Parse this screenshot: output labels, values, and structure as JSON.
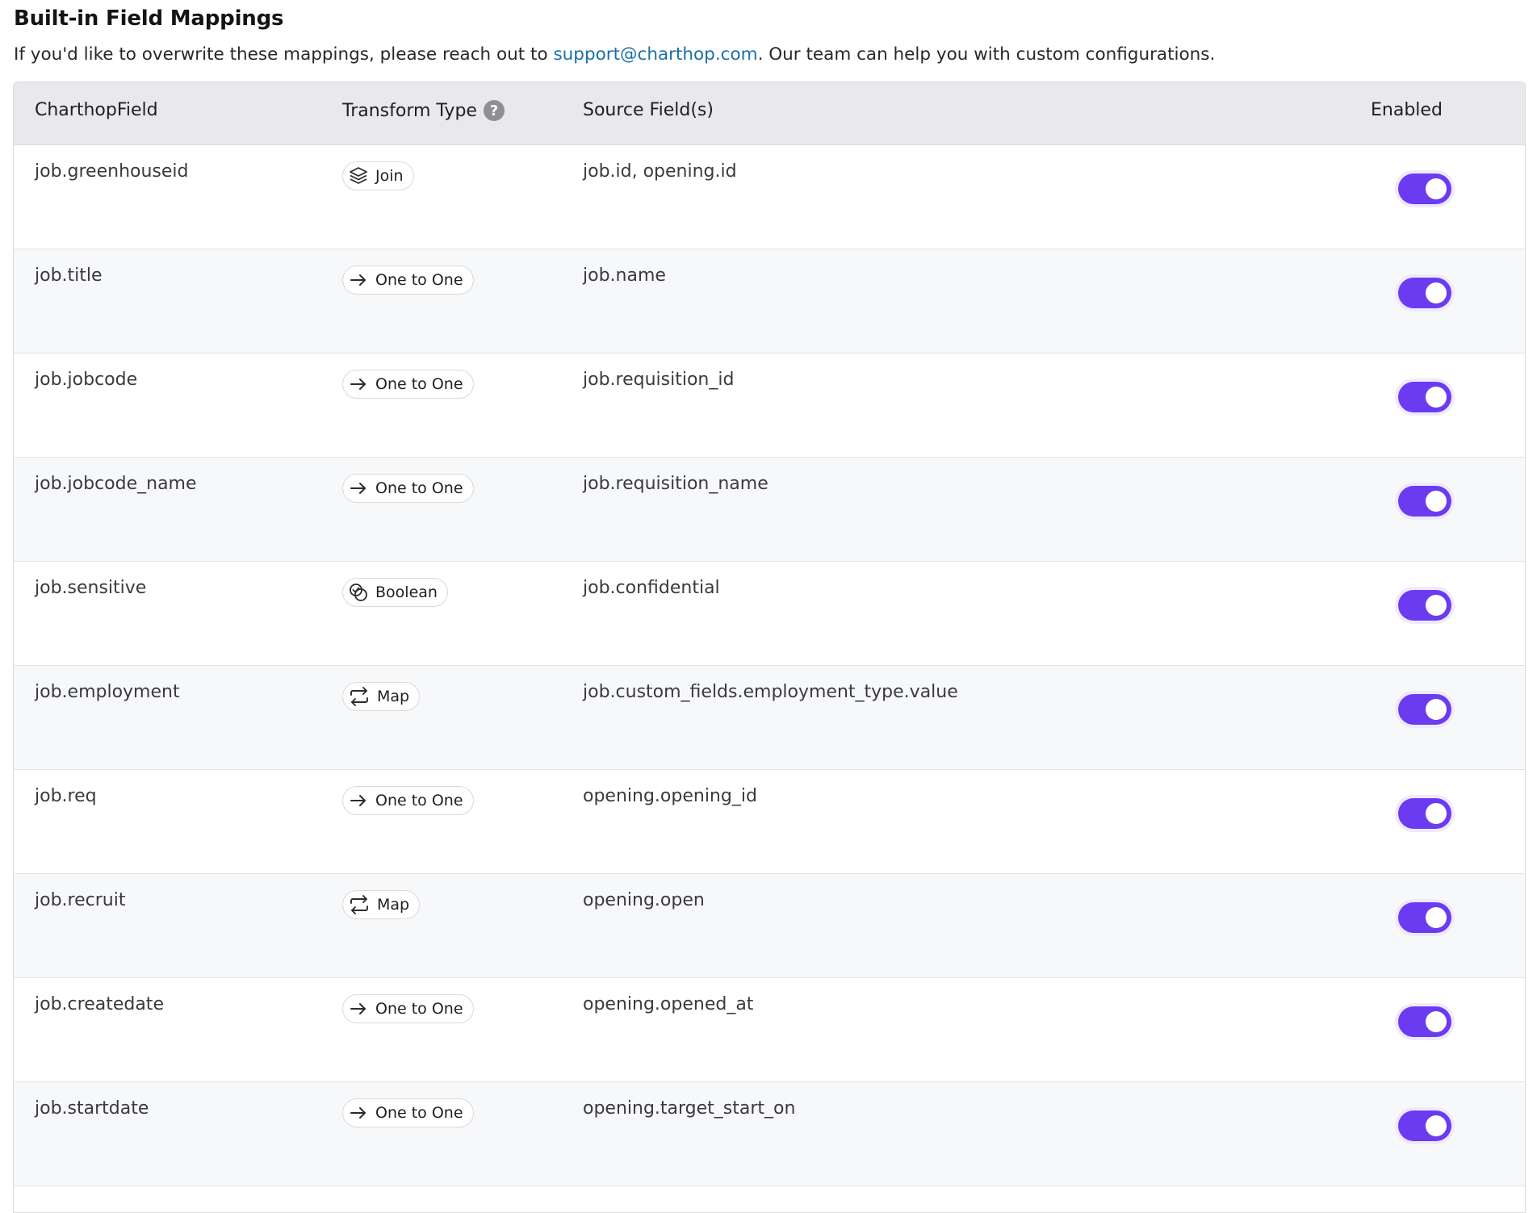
{
  "header": {
    "title": "Built-in Field Mappings",
    "subtitle_before": "If you'd like to overwrite these mappings, please reach out to ",
    "support_email": "support@charthop.com",
    "subtitle_after": ". Our team can help you with custom configurations."
  },
  "table": {
    "columns": {
      "field": "CharthopField",
      "transform": "Transform Type",
      "source": "Source Field(s)",
      "enabled": "Enabled"
    },
    "help_icon": "help-circle-icon",
    "rows": [
      {
        "field": "job.greenhouseid",
        "transform": "Join",
        "transform_icon": "layers-icon",
        "source": "job.id, opening.id",
        "enabled": true
      },
      {
        "field": "job.title",
        "transform": "One to One",
        "transform_icon": "arrow-right-icon",
        "source": "job.name",
        "enabled": true
      },
      {
        "field": "job.jobcode",
        "transform": "One to One",
        "transform_icon": "arrow-right-icon",
        "source": "job.requisition_id",
        "enabled": true
      },
      {
        "field": "job.jobcode_name",
        "transform": "One to One",
        "transform_icon": "arrow-right-icon",
        "source": "job.requisition_name",
        "enabled": true
      },
      {
        "field": "job.sensitive",
        "transform": "Boolean",
        "transform_icon": "boolean-icon",
        "source": "job.confidential",
        "enabled": true
      },
      {
        "field": "job.employment",
        "transform": "Map",
        "transform_icon": "swap-icon",
        "source": "job.custom_fields.employment_type.value",
        "enabled": true
      },
      {
        "field": "job.req",
        "transform": "One to One",
        "transform_icon": "arrow-right-icon",
        "source": "opening.opening_id",
        "enabled": true
      },
      {
        "field": "job.recruit",
        "transform": "Map",
        "transform_icon": "swap-icon",
        "source": "opening.open",
        "enabled": true
      },
      {
        "field": "job.createdate",
        "transform": "One to One",
        "transform_icon": "arrow-right-icon",
        "source": "opening.opened_at",
        "enabled": true
      },
      {
        "field": "job.startdate",
        "transform": "One to One",
        "transform_icon": "arrow-right-icon",
        "source": "opening.target_start_on",
        "enabled": true
      }
    ]
  },
  "colors": {
    "toggle_on": "#6b3bf1",
    "link": "#1b6fa8",
    "header_bg": "#e9e8ed"
  }
}
